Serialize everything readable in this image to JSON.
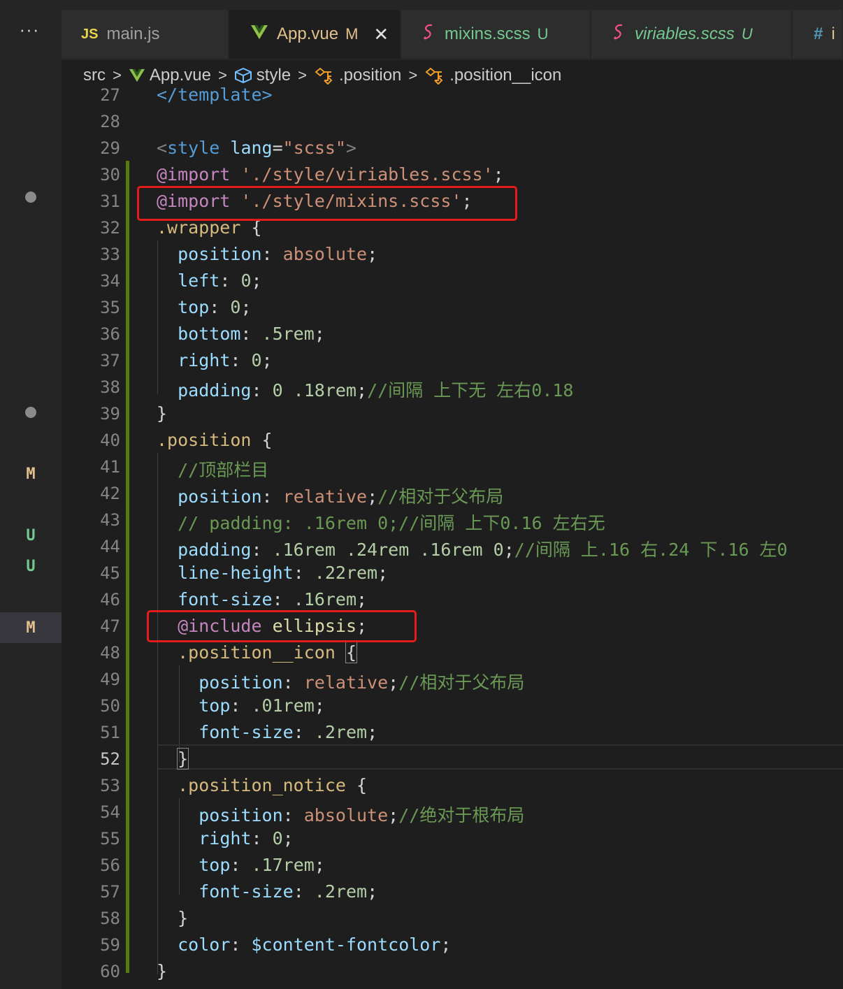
{
  "tabs": [
    {
      "icon": "JS",
      "label": "main.js",
      "badge": "",
      "active": false
    },
    {
      "icon": "V",
      "label": "App.vue",
      "badge": "M",
      "active": true
    },
    {
      "icon": "S",
      "label": "mixins.scss",
      "badge": "U",
      "active": false
    },
    {
      "icon": "S",
      "label": "viriables.scss",
      "badge": "U",
      "active": false
    },
    {
      "icon": "#",
      "label": "i",
      "badge": "",
      "active": false
    }
  ],
  "more_label": "···",
  "breadcrumb": [
    "src",
    "App.vue",
    "style",
    ".position",
    ".position__icon"
  ],
  "scm_letters": {
    "l41": "M",
    "l43": "U",
    "l44": "U",
    "l47": "M"
  },
  "code": {
    "l27": {
      "num": "27",
      "close_tag": "</template>"
    },
    "l28": {
      "num": "28"
    },
    "l29": {
      "num": "29",
      "tag": "style",
      "attr": "lang",
      "eq": "=",
      "val": "\"scss\""
    },
    "l30": {
      "num": "30",
      "kw": "@import",
      "str": "'./style/viriables.scss'"
    },
    "l31": {
      "num": "31",
      "kw": "@import",
      "str": "'./style/mixins.scss'"
    },
    "l32": {
      "num": "32",
      "sel": ".wrapper"
    },
    "l33": {
      "num": "33",
      "prop": "position",
      "val": "absolute"
    },
    "l34": {
      "num": "34",
      "prop": "left",
      "val": "0"
    },
    "l35": {
      "num": "35",
      "prop": "top",
      "val": "0"
    },
    "l36": {
      "num": "36",
      "prop": "bottom",
      "val": ".5rem"
    },
    "l37": {
      "num": "37",
      "prop": "right",
      "val": "0"
    },
    "l38": {
      "num": "38",
      "prop": "padding",
      "val": "0 .18rem",
      "comment": "//间隔 上下无 左右0.18"
    },
    "l39": {
      "num": "39"
    },
    "l40": {
      "num": "40",
      "sel": ".position"
    },
    "l41": {
      "num": "41",
      "comment": "//顶部栏目"
    },
    "l42": {
      "num": "42",
      "prop": "position",
      "val": "relative",
      "comment": "//相对于父布局"
    },
    "l43": {
      "num": "43",
      "comment": "// padding: .16rem 0;//间隔 上下0.16 左右无"
    },
    "l44": {
      "num": "44",
      "prop": "padding",
      "val": ".16rem .24rem .16rem 0",
      "comment": "//间隔 上.16 右.24 下.16 左0"
    },
    "l45": {
      "num": "45",
      "prop": "line-height",
      "val": ".22rem"
    },
    "l46": {
      "num": "46",
      "prop": "font-size",
      "val": ".16rem"
    },
    "l47": {
      "num": "47",
      "kw": "@include",
      "fn": "ellipsis"
    },
    "l48": {
      "num": "48",
      "sel": ".position__icon"
    },
    "l49": {
      "num": "49",
      "prop": "position",
      "val": "relative",
      "comment": "//相对于父布局"
    },
    "l50": {
      "num": "50",
      "prop": "top",
      "val": ".01rem"
    },
    "l51": {
      "num": "51",
      "prop": "font-size",
      "val": ".2rem"
    },
    "l52": {
      "num": "52"
    },
    "l53": {
      "num": "53",
      "sel": ".position_notice"
    },
    "l54": {
      "num": "54",
      "prop": "position",
      "val": "absolute",
      "comment": "//绝对于根布局"
    },
    "l55": {
      "num": "55",
      "prop": "right",
      "val": "0"
    },
    "l56": {
      "num": "56",
      "prop": "top",
      "val": ".17rem"
    },
    "l57": {
      "num": "57",
      "prop": "font-size",
      "val": ".2rem"
    },
    "l58": {
      "num": "58"
    },
    "l59": {
      "num": "59",
      "prop": "color",
      "val": "$content-fontcolor"
    },
    "l60": {
      "num": "60"
    }
  },
  "colors": {
    "accent_modified": "#e2c08d",
    "untracked": "#73c991",
    "highlight_box": "#e51c1c",
    "vue_green": "#8dc149",
    "scss_pink": "#f55385"
  }
}
